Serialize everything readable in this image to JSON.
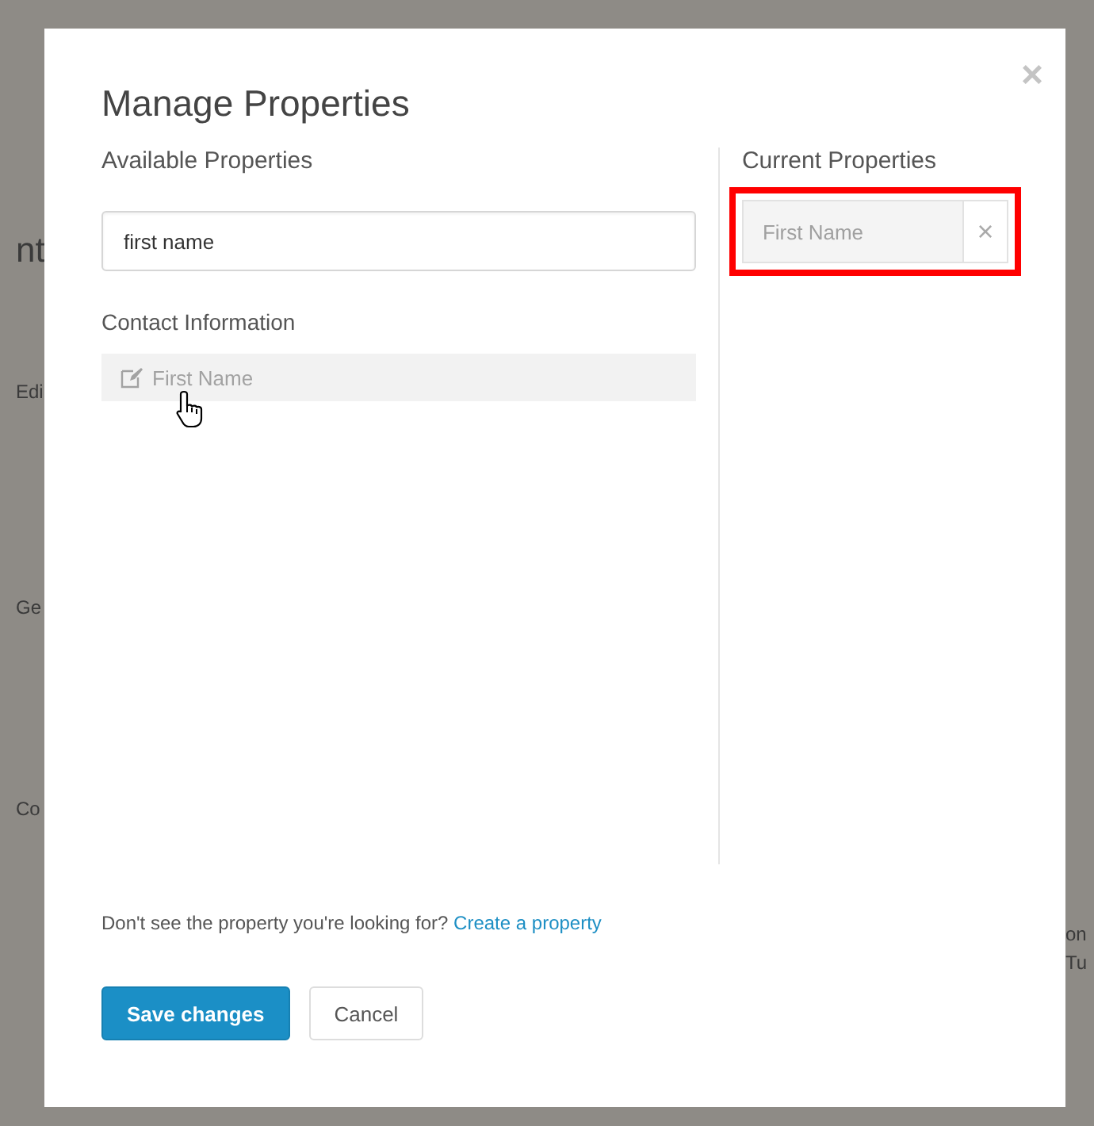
{
  "backdrop": {
    "left_fragments": [
      "nt",
      "Edi",
      "Ge",
      "Co"
    ],
    "right_fragments": [
      "on",
      "Tu"
    ]
  },
  "dialog": {
    "title": "Manage Properties",
    "close": "×"
  },
  "available": {
    "heading": "Available Properties",
    "search": {
      "value": "first name"
    },
    "groups": [
      {
        "name": "Contact Information",
        "items": [
          {
            "label": "First Name",
            "added": true,
            "hovered": true
          }
        ]
      }
    ]
  },
  "current": {
    "heading": "Current Properties",
    "items": [
      {
        "label": "First Name",
        "remove": "×",
        "highlighted": true
      }
    ]
  },
  "footer": {
    "hint": "Don't see the property you're looking for?",
    "link": "Create a property"
  },
  "buttons": [
    {
      "label": "Save changes",
      "kind": "primary"
    },
    {
      "label": "Cancel",
      "kind": "default"
    }
  ]
}
